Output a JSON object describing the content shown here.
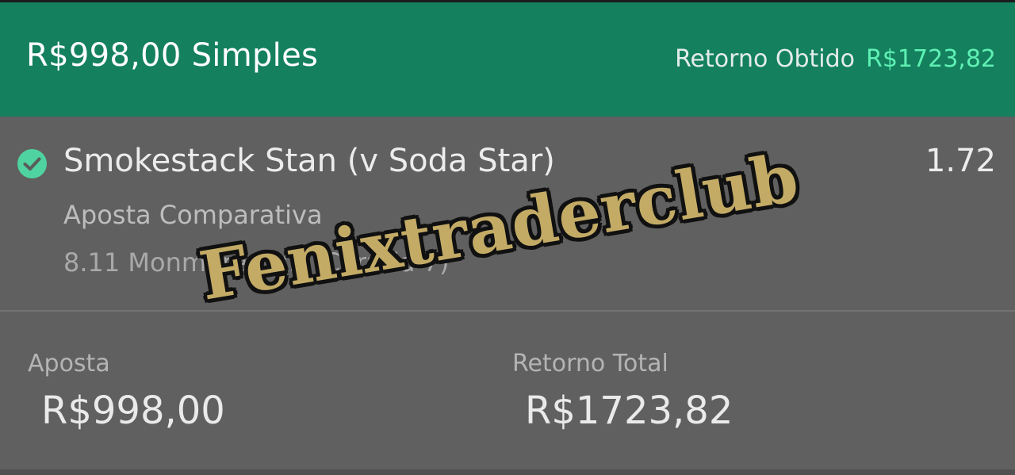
{
  "header": {
    "title": "R$998,00 Simples",
    "return_label": "Retorno Obtido",
    "return_value": "R$1723,82"
  },
  "selection": {
    "icon": "check-circle-icon",
    "name": "Smokestack Stan (v Soda Star)",
    "odds": "1.72",
    "market": "Aposta Comparativa",
    "event": "8.11 Monmore EVE (Corrida 7)"
  },
  "summary": {
    "stake_label": "Aposta",
    "stake_value": "R$998,00",
    "total_label": "Retorno Total",
    "total_value": "R$1723,82"
  },
  "watermark": {
    "text": "Fenixtraderclub"
  },
  "colors": {
    "header_bg": "#14805e",
    "accent_green": "#5ff0b4",
    "body_bg": "#606060",
    "watermark_fill": "#c3ab66"
  }
}
